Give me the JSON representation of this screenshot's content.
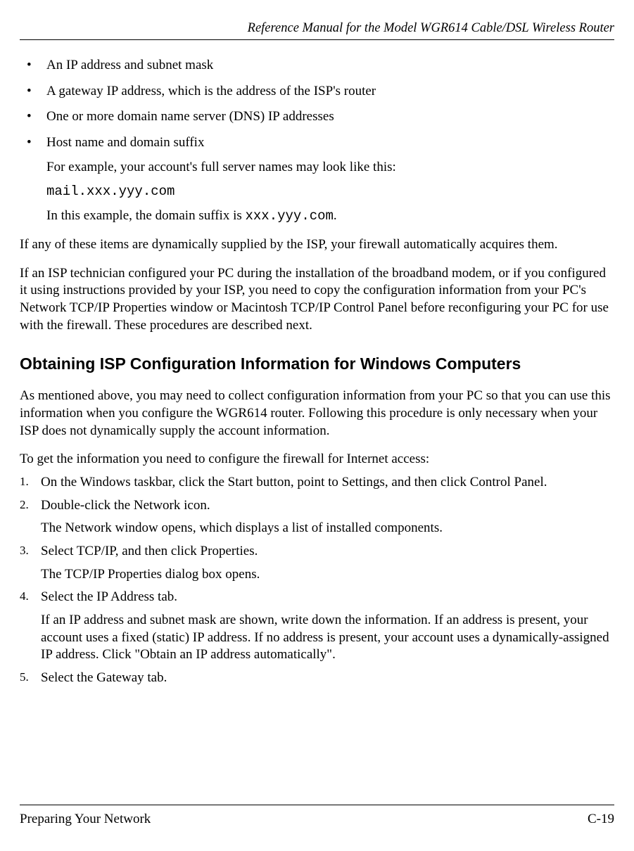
{
  "header": {
    "title": "Reference Manual for the Model WGR614 Cable/DSL Wireless Router"
  },
  "bullets": [
    {
      "text": "An IP address and subnet mask"
    },
    {
      "text": "A gateway IP address, which is the address of the ISP's router"
    },
    {
      "text": "One or more domain name server (DNS) IP addresses"
    },
    {
      "text": "Host name and domain suffix",
      "sub1": "For example, your account's full server names may look like this:",
      "code": "mail.xxx.yyy.com",
      "sub2_pre": "In this example, the domain suffix is ",
      "sub2_code": "xxx.yyy.com",
      "sub2_post": "."
    }
  ],
  "paras": {
    "p1": "If any of these items are dynamically supplied by the ISP, your firewall automatically acquires them.",
    "p2": "If an ISP technician configured your PC during the installation of the broadband modem, or if you configured it using instructions provided by your ISP, you need to copy the configuration information from your PC's Network TCP/IP Properties window or Macintosh TCP/IP Control Panel before reconfiguring your PC for use with the firewall. These procedures are described next."
  },
  "section": {
    "heading": "Obtaining ISP Configuration Information for Windows Computers",
    "intro": "As mentioned above, you may need to collect configuration information from your PC so that you can use this information when you configure the WGR614 router. Following this procedure is only necessary when your ISP does not dynamically supply the account information.",
    "lead": "To get the information you need to configure the firewall for Internet access:"
  },
  "steps": [
    {
      "num": "1.",
      "text": "On the Windows taskbar, click the Start button, point to Settings, and then click Control Panel."
    },
    {
      "num": "2.",
      "text": "Double-click the Network icon.",
      "sub": "The Network window opens, which displays a list of installed components."
    },
    {
      "num": "3.",
      "text": "Select TCP/IP, and then click Properties.",
      "sub": "The TCP/IP Properties dialog box opens."
    },
    {
      "num": "4.",
      "text": "Select the IP Address tab.",
      "sub": "If an IP address and subnet mask are shown, write down the information. If an address is present, your account uses a fixed (static) IP address. If no address is present, your account uses a dynamically-assigned IP address. Click \"Obtain an IP address automatically\"."
    },
    {
      "num": "5.",
      "text": "Select the Gateway tab."
    }
  ],
  "footer": {
    "left": "Preparing Your Network",
    "right": "C-19"
  }
}
